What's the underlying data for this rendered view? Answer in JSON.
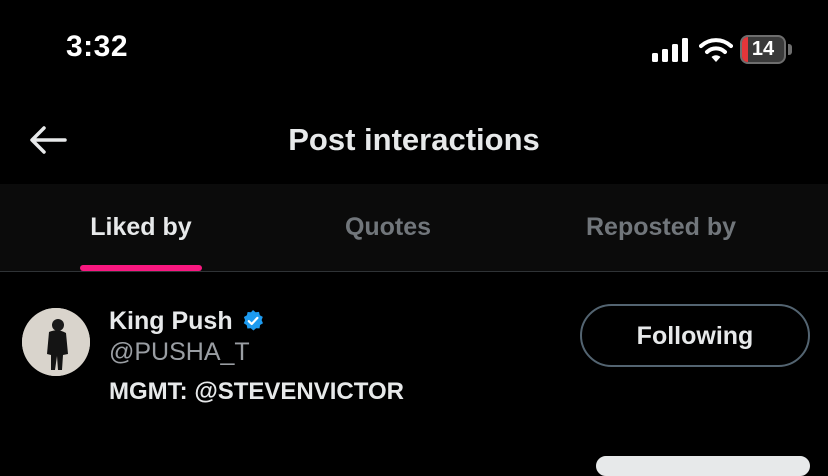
{
  "status_bar": {
    "time": "3:32",
    "battery_level": "14",
    "battery_fraction": 0.14,
    "battery_color": "#e4363a",
    "icons": [
      "signal-icon",
      "wifi-icon",
      "battery-icon"
    ]
  },
  "header": {
    "title": "Post interactions",
    "back_icon": "arrow-left-icon"
  },
  "tabs": [
    {
      "label": "Liked by",
      "active": true
    },
    {
      "label": "Quotes",
      "active": false
    },
    {
      "label": "Reposted by",
      "active": false
    }
  ],
  "theme": {
    "background": "#000000",
    "text": "#e7e9ea",
    "muted": "#71767b",
    "tab_indicator": "#f91880",
    "verified_badge": "#1d9bf0"
  },
  "users": [
    {
      "display_name": "King Push",
      "verified": true,
      "handle": "@PUSHA_T",
      "bio": "MGMT: @STEVENVICTOR",
      "follow_label": "Following"
    }
  ]
}
